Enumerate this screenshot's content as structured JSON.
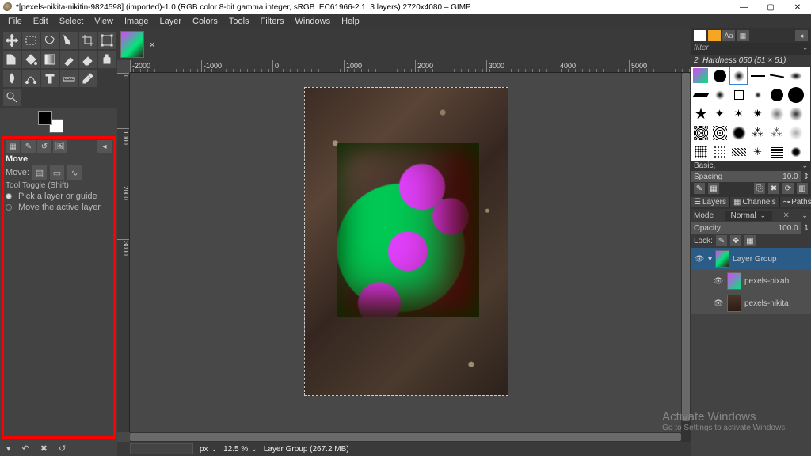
{
  "app": {
    "title": "*[pexels-nikita-nikitin-9824598] (imported)-1.0 (RGB color 8-bit gamma integer, sRGB IEC61966-2.1, 3 layers) 2720x4080 – GIMP"
  },
  "menu": {
    "items": [
      "File",
      "Edit",
      "Select",
      "View",
      "Image",
      "Layer",
      "Colors",
      "Tools",
      "Filters",
      "Windows",
      "Help"
    ]
  },
  "tool_options": {
    "title": "Move",
    "row_label": "Move:",
    "toggle_label": "Tool Toggle  (Shift)",
    "radios": [
      "Pick a layer or guide",
      "Move the active layer"
    ],
    "active_radio": 0
  },
  "ruler": {
    "h": [
      "-2000",
      "-1000",
      "0",
      "1000",
      "2000",
      "3000",
      "4000",
      "5000"
    ],
    "v": [
      "0",
      "1000",
      "2000",
      "3000"
    ]
  },
  "status": {
    "unit": "px",
    "zoom": "12.5 %",
    "info": "Layer Group (267.2 MB)"
  },
  "brush_panel": {
    "filter": "filter",
    "label": "2. Hardness 050 (51 × 51)",
    "mode": "Basic,",
    "spacing_label": "Spacing",
    "spacing_value": "10.0"
  },
  "layer_tabs": [
    "Layers",
    "Channels",
    "Paths"
  ],
  "layer_panel": {
    "mode_label": "Mode",
    "mode_value": "Normal",
    "opacity_label": "Opacity",
    "opacity_value": "100.0",
    "lock_label": "Lock:"
  },
  "layers": [
    {
      "name": "Layer Group",
      "selected": true,
      "child": false,
      "t": "img1"
    },
    {
      "name": "pexels-pixab",
      "selected": false,
      "child": true,
      "t": "img2"
    },
    {
      "name": "pexels-nikita",
      "selected": false,
      "child": true,
      "t": "img3"
    }
  ],
  "watermark": {
    "title": "Activate Windows",
    "sub": "Go to Settings to activate Windows."
  }
}
